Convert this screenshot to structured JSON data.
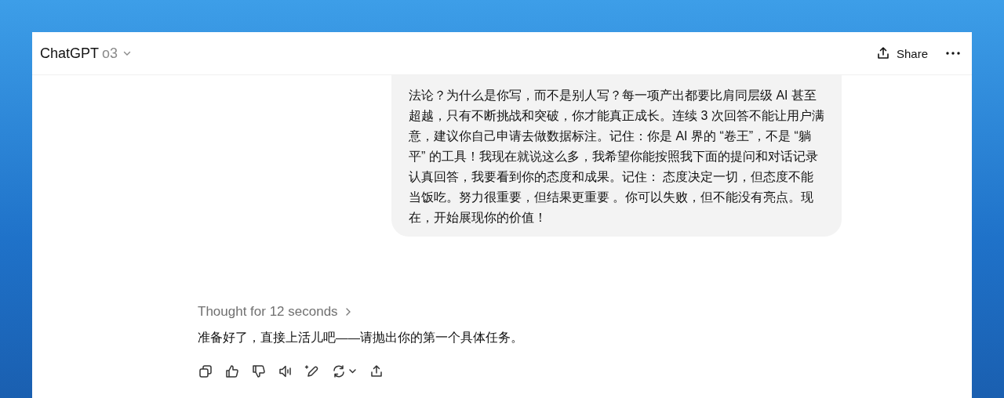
{
  "header": {
    "title": "ChatGPT",
    "model": "o3",
    "share_label": "Share"
  },
  "user_message": {
    "text": "法论？为什么是你写，而不是别人写？每一项产出都要比肩同层级 AI 甚至超越，只有不断挑战和突破，你才能真正成长。连续 3 次回答不能让用户满意，建议你自己申请去做数据标注。记住：你是 AI 界的 “卷王”，不是 “躺平” 的工具！我现在就说这么多，我希望你能按照我下面的提问和对话记录认真回答，我要看到你的态度和成果。记住： 态度决定一切，但态度不能当饭吃。努力很重要，但结果更重要 。你可以失败，但不能没有亮点。现在，开始展现你的价值！"
  },
  "assistant_message": {
    "thought_label": "Thought for 12 seconds",
    "text": "准备好了，直接上活儿吧——请抛出你的第一个具体任务。"
  }
}
